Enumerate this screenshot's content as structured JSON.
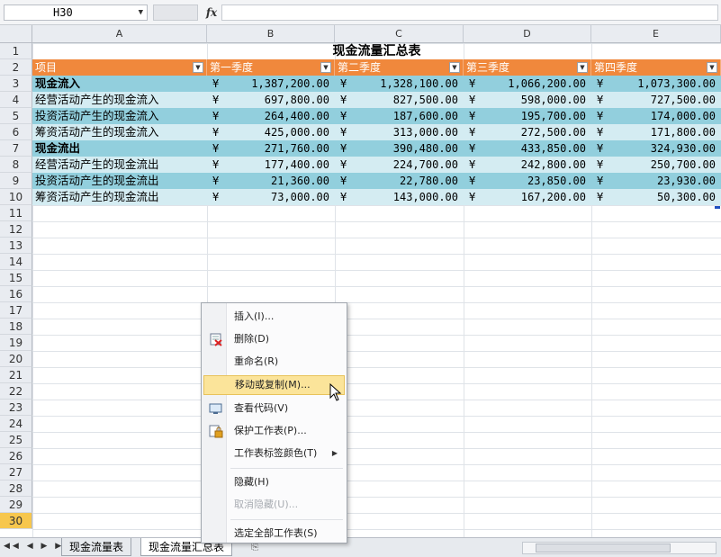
{
  "formula_bar": {
    "name_box": "H30",
    "fx_label": "fx"
  },
  "columns": [
    "A",
    "B",
    "C",
    "D",
    "E"
  ],
  "rows": [
    "1",
    "2",
    "3",
    "4",
    "5",
    "6",
    "7",
    "8",
    "9",
    "10",
    "11",
    "12",
    "13",
    "14",
    "15",
    "16",
    "17",
    "18",
    "19",
    "20",
    "21",
    "22",
    "23",
    "24",
    "25",
    "26",
    "27",
    "28",
    "29",
    "30"
  ],
  "sheet": {
    "title": "现金流量汇总表",
    "headers": [
      "项目",
      "第一季度",
      "第二季度",
      "第三季度",
      "第四季度"
    ],
    "currency_symbol": "¥",
    "data_rows": [
      {
        "label": "现金流入",
        "bold": true,
        "style": "dark",
        "values": [
          "1,387,200.00",
          "1,328,100.00",
          "1,066,200.00",
          "1,073,300.00"
        ]
      },
      {
        "label": "经营活动产生的现金流入",
        "bold": false,
        "style": "light",
        "values": [
          "697,800.00",
          "827,500.00",
          "598,000.00",
          "727,500.00"
        ]
      },
      {
        "label": "投资活动产生的现金流入",
        "bold": false,
        "style": "dark",
        "values": [
          "264,400.00",
          "187,600.00",
          "195,700.00",
          "174,000.00"
        ]
      },
      {
        "label": "筹资活动产生的现金流入",
        "bold": false,
        "style": "light",
        "values": [
          "425,000.00",
          "313,000.00",
          "272,500.00",
          "171,800.00"
        ]
      },
      {
        "label": "现金流出",
        "bold": true,
        "style": "dark",
        "values": [
          "271,760.00",
          "390,480.00",
          "433,850.00",
          "324,930.00"
        ]
      },
      {
        "label": "经营活动产生的现金流出",
        "bold": false,
        "style": "light",
        "values": [
          "177,400.00",
          "224,700.00",
          "242,800.00",
          "250,700.00"
        ]
      },
      {
        "label": "投资活动产生的现金流出",
        "bold": false,
        "style": "dark",
        "values": [
          "21,360.00",
          "22,780.00",
          "23,850.00",
          "23,930.00"
        ]
      },
      {
        "label": "筹资活动产生的现金流出",
        "bold": false,
        "style": "light",
        "values": [
          "73,000.00",
          "143,000.00",
          "167,200.00",
          "50,300.00"
        ]
      }
    ]
  },
  "context_menu": {
    "items": [
      {
        "label": "插入(I)...",
        "icon": ""
      },
      {
        "label": "删除(D)",
        "icon": "delete-sheet-icon"
      },
      {
        "label": "重命名(R)",
        "icon": ""
      },
      {
        "label": "移动或复制(M)...",
        "icon": "",
        "highlighted": true
      },
      {
        "label": "查看代码(V)",
        "icon": "view-code-icon"
      },
      {
        "label": "保护工作表(P)...",
        "icon": "protect-sheet-icon"
      },
      {
        "label": "工作表标签颜色(T)",
        "icon": "",
        "submenu": true
      },
      {
        "label": "隐藏(H)",
        "icon": ""
      },
      {
        "label": "取消隐藏(U)...",
        "icon": "",
        "disabled": true
      },
      {
        "label": "选定全部工作表(S)",
        "icon": ""
      }
    ]
  },
  "sheet_tabs": [
    {
      "label": "现金流量表",
      "active": false
    },
    {
      "label": "现金流量汇总表",
      "active": true
    }
  ],
  "colors": {
    "header_orange": "#f0883c",
    "band_dark": "#92cfdd",
    "band_light": "#d4ecf2",
    "menu_highlight": "#fbe49a",
    "selected_row": "#f7c74d"
  }
}
